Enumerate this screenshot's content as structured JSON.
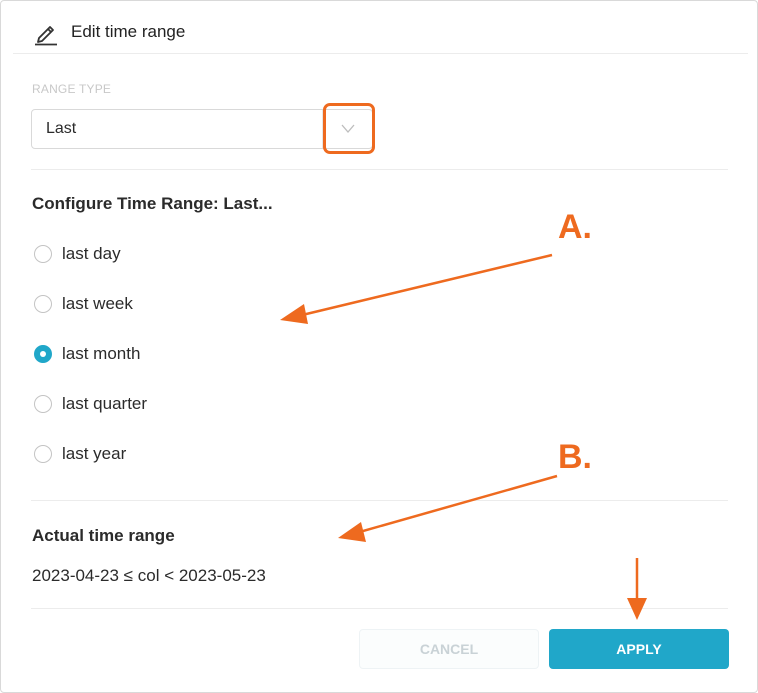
{
  "header": {
    "title": "Edit time range",
    "icon": "pencil-icon"
  },
  "range_type": {
    "label": "RANGE TYPE",
    "selected": "Last",
    "chevron_icon": "chevron-down-icon"
  },
  "configure": {
    "title": "Configure Time Range: Last...",
    "options": [
      {
        "label": "last day",
        "checked": false
      },
      {
        "label": "last week",
        "checked": false
      },
      {
        "label": "last month",
        "checked": true
      },
      {
        "label": "last quarter",
        "checked": false
      },
      {
        "label": "last year",
        "checked": false
      }
    ]
  },
  "actual": {
    "title": "Actual time range",
    "value": "2023-04-23 ≤ col < 2023-05-23"
  },
  "buttons": {
    "cancel": "CANCEL",
    "apply": "APPLY"
  },
  "annotations": {
    "a": "A.",
    "b": "B."
  },
  "colors": {
    "accent": "#20a7c9",
    "annotation": "#ee6a1f",
    "disabled_text": "#c9d2d6"
  }
}
